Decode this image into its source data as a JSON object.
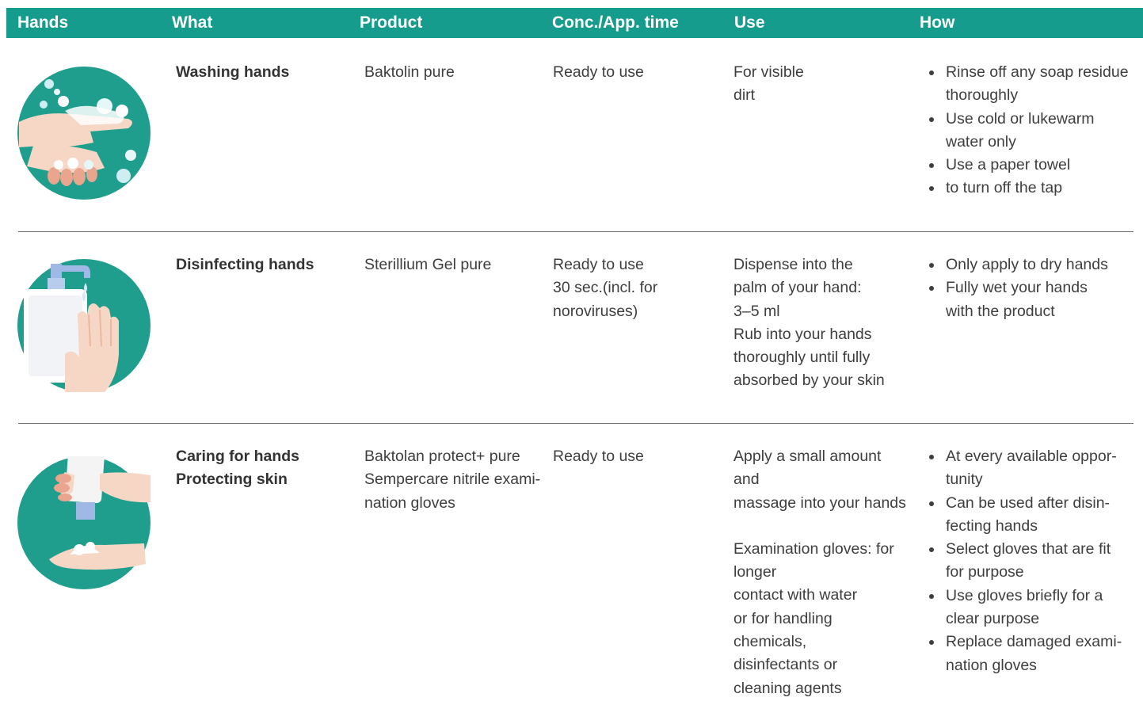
{
  "header": {
    "hands": "Hands",
    "what": "What",
    "product": "Product",
    "conc": "Conc./App. time",
    "use": "Use",
    "how": "How"
  },
  "colors": {
    "header_bg": "#169c8c",
    "icon_circle": "#1f9e8e"
  },
  "rows": [
    {
      "icon": "washing-hands-icon",
      "what": [
        "Washing hands"
      ],
      "product": [
        "Baktolin pure"
      ],
      "conc": [
        "Ready to use"
      ],
      "use": [
        "For visible",
        "dirt"
      ],
      "how": [
        [
          "Rinse off any soap residue",
          "thoroughly"
        ],
        [
          "Use cold or lukewarm",
          "water only"
        ],
        [
          "Use a paper towel"
        ],
        [
          "to turn off the tap"
        ]
      ]
    },
    {
      "icon": "disinfecting-hands-icon",
      "what": [
        "Disinfecting hands"
      ],
      "product": [
        "Sterillium Gel pure"
      ],
      "conc": [
        "Ready to use",
        "30 sec.(incl. for",
        "noroviruses)"
      ],
      "use": [
        "Dispense into the",
        "palm of your hand:",
        "3–5 ml",
        "Rub into your hands",
        "thoroughly until fully",
        "absorbed by your skin"
      ],
      "how": [
        [
          "Only apply to dry hands"
        ],
        [
          "Fully wet your hands",
          "with the product"
        ]
      ]
    },
    {
      "icon": "caring-hands-icon",
      "what": [
        "Caring for hands",
        "Protecting skin"
      ],
      "product": [
        "Baktolan protect+ pure",
        "Sempercare nitrile exami-",
        "nation gloves"
      ],
      "conc": [
        "Ready to use"
      ],
      "use_a": [
        "Apply a small amount",
        "and",
        "massage into your hands"
      ],
      "use_b": [
        "Examination gloves: for",
        "longer",
        "contact with water",
        "or for handling",
        "chemicals,",
        "disinfectants or",
        "cleaning agents"
      ],
      "how": [
        [
          "At every available oppor-",
          "tunity"
        ],
        [
          "Can be used after disin-",
          "fecting hands"
        ],
        [
          "Select gloves that are fit",
          "for purpose"
        ],
        [
          "Use gloves briefly for a",
          "clear purpose"
        ],
        [
          "Replace damaged exami-",
          "nation gloves"
        ]
      ]
    }
  ]
}
